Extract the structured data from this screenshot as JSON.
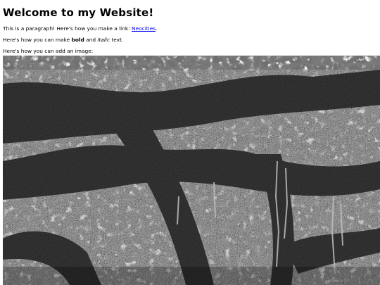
{
  "page": {
    "heading": "Welcome to my Website!",
    "paragraph1": {
      "text": "This is a paragraph! Here's how you make a link: ",
      "link_label": "Neocities",
      "trailing": "."
    },
    "paragraph2": {
      "prefix": "Here's how you can make ",
      "bold": "bold",
      "middle": " and ",
      "italic": "italic",
      "suffix": " text."
    },
    "paragraph3": {
      "text": "Here's how you can add an image:"
    },
    "image": {
      "subject": "grayscale photo of tree branches with hanging moss"
    }
  },
  "colors": {
    "link": "#0000ee",
    "text": "#000000",
    "background": "#ffffff"
  }
}
